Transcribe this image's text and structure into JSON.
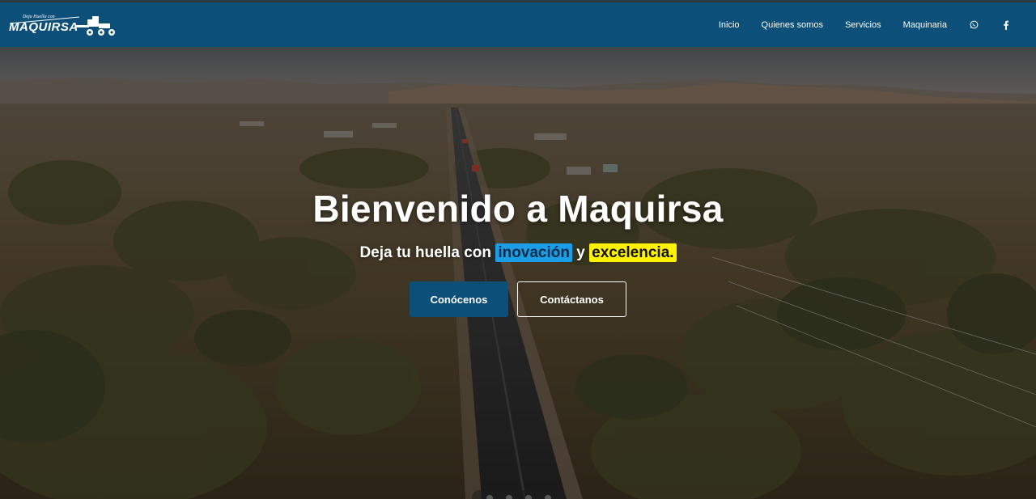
{
  "brand": {
    "tagline": "Deja Huella con",
    "name": "MAQUIRSA"
  },
  "nav": {
    "items": [
      {
        "label": "Inicio"
      },
      {
        "label": "Quienes somos"
      },
      {
        "label": "Servicios"
      },
      {
        "label": "Maquinaria"
      }
    ],
    "icons": [
      "whatsapp-icon",
      "facebook-icon"
    ]
  },
  "hero": {
    "title": "Bienvenido a Maquirsa",
    "subtitle_prefix": "Deja tu huella con",
    "highlight_1": "inovación",
    "connector": "y",
    "highlight_2": "excelencia.",
    "primary_button": "Conócenos",
    "secondary_button": "Contáctanos"
  },
  "colors": {
    "navbar": "#0c4f78",
    "primary_button": "#0c4f78",
    "highlight_blue": "#1b9ee6",
    "highlight_yellow": "#fff200"
  }
}
